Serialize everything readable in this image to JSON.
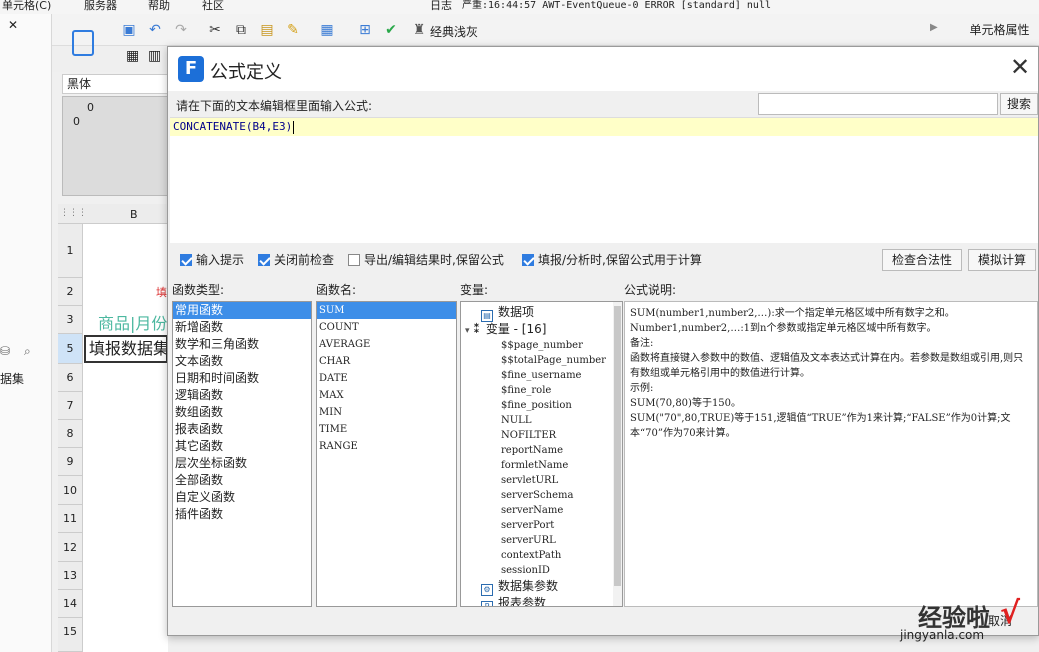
{
  "menubar": {
    "items": [
      "单元格(C)",
      "服务器",
      "帮助",
      "社区"
    ],
    "log_label": "日志",
    "log_text": "严重:16:44:57 AWT-EventQueue-0 ERROR [standard] null"
  },
  "toolbar": {
    "theme_label": "经典浅灰",
    "cell_props_tab": "单元格属性",
    "font_name": "黑体"
  },
  "left_panel": {
    "label": "据集"
  },
  "sheet": {
    "column_b": "B",
    "ruler_zero": "0",
    "rows": [
      "1",
      "2",
      "3",
      "5",
      "6",
      "7",
      "8",
      "9",
      "10",
      "11",
      "12",
      "13",
      "14",
      "15"
    ],
    "cell_row2": "填",
    "cell_row3": "商品|月份",
    "cell_row5": "填报数据集"
  },
  "dialog": {
    "title": "公式定义",
    "prompt": "请在下面的文本编辑框里面输入公式:",
    "search_button": "搜索",
    "formula": "CONCATENATE(B4,E3)",
    "checkboxes": [
      {
        "label": "输入提示",
        "checked": true
      },
      {
        "label": "关闭前检查",
        "checked": true
      },
      {
        "label": "导出/编辑结果时,保留公式",
        "checked": false
      },
      {
        "label": "填报/分析时,保留公式用于计算",
        "checked": true
      }
    ],
    "check_validity_button": "检查合法性",
    "simulate_button": "模拟计算",
    "cancel_button": "取消",
    "function_type_label": "函数类型:",
    "function_types": [
      "常用函数",
      "新增函数",
      "数学和三角函数",
      "文本函数",
      "日期和时间函数",
      "逻辑函数",
      "数组函数",
      "报表函数",
      "其它函数",
      "层次坐标函数",
      "全部函数",
      "自定义函数",
      "插件函数"
    ],
    "function_name_label": "函数名:",
    "function_names": [
      "SUM",
      "COUNT",
      "AVERAGE",
      "CHAR",
      "DATE",
      "MAX",
      "MIN",
      "TIME",
      "RANGE"
    ],
    "variable_label": "变量:",
    "variables": {
      "data_item": "数据项",
      "variable_group": "变量 - [16]",
      "items": [
        "$$page_number",
        "$$totalPage_number",
        "$fine_username",
        "$fine_role",
        "$fine_position",
        "NULL",
        "NOFILTER",
        "reportName",
        "formletName",
        "servletURL",
        "serverSchema",
        "serverName",
        "serverPort",
        "serverURL",
        "contextPath",
        "sessionID"
      ],
      "dataset_params": "数据集参数",
      "report_params": "报表参数"
    },
    "description_label": "公式说明:",
    "description": [
      "SUM(number1,number2,…):求一个指定单元格区域中所有数字之和。",
      "Number1,number2,…:1到n个参数或指定单元格区域中所有数字。",
      "备注:",
      "函数将直接键入参数中的数值、逻辑值及文本表达式计算在内。若参数是数组或引用,则只有数组或单元格引用中的数值进行计算。",
      "示例:",
      "SUM(70,80)等于150。",
      "SUM(\"70\",80,TRUE)等于151,逻辑值“TRUE”作为1来计算;“FALSE”作为0计算;文本“70”作为70来计算。"
    ]
  },
  "watermark": {
    "line1": "经验啦",
    "line2": "jingyanla.com"
  }
}
